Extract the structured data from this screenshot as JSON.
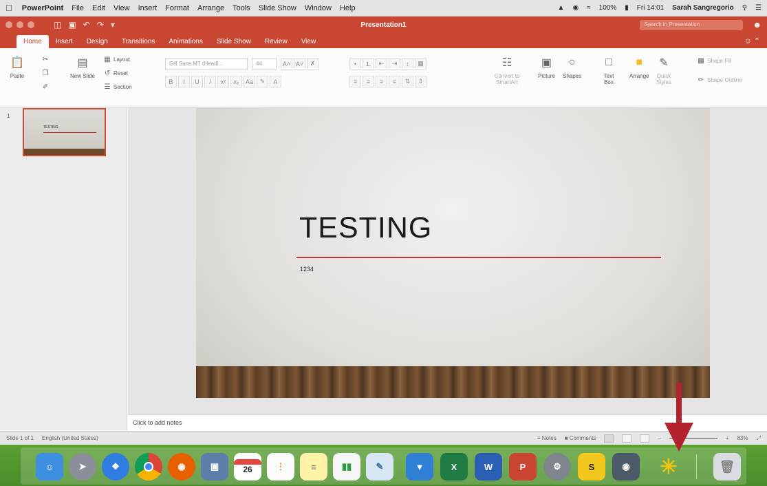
{
  "menubar": {
    "app_name": "PowerPoint",
    "items": [
      "File",
      "Edit",
      "View",
      "Insert",
      "Format",
      "Arrange",
      "Tools",
      "Slide Show",
      "Window",
      "Help"
    ],
    "battery": "100%",
    "clock": "Fri 14:01",
    "user": "Sarah Sangregorio"
  },
  "titlebar": {
    "document_title": "Presentation1",
    "search_placeholder": "Search in Presentation"
  },
  "tabs": [
    "Home",
    "Insert",
    "Design",
    "Transitions",
    "Animations",
    "Slide Show",
    "Review",
    "View"
  ],
  "ribbon": {
    "paste": "Paste",
    "new_slide": "New Slide",
    "layout": "Layout",
    "reset": "Reset",
    "section": "Section",
    "font_name": "Gill Sans MT (Headi...",
    "font_size": "44",
    "convert_smartart": "Convert to SmartArt",
    "picture": "Picture",
    "shapes": "Shapes",
    "text_box": "Text Box",
    "arrange": "Arrange",
    "quick_styles": "Quick Styles",
    "shape_fill": "Shape Fill",
    "shape_outline": "Shape Outline"
  },
  "thumbnails": {
    "slide_number": "1",
    "thumb_title": "TESTING"
  },
  "slide": {
    "title": "TESTING",
    "subtitle": "1234"
  },
  "notes": {
    "placeholder": "Click to add notes"
  },
  "statusbar": {
    "slide_info": "Slide 1 of 1",
    "language": "English (United States)",
    "notes_label": "Notes",
    "comments_label": "Comments",
    "zoom": "83%"
  },
  "colors": {
    "accent": "#c94732",
    "slide_rule": "#b9353a",
    "dock_bg": "#4a8c2a",
    "arrow": "#b3232f"
  },
  "dock": {
    "calendar_day": "26",
    "apps": [
      "Finder",
      "Launchpad",
      "Safari",
      "Chrome",
      "Firefox",
      "Preview",
      "Calendar",
      "Reminders",
      "Notes",
      "Numbers",
      "Preview",
      "Keynote",
      "Excel",
      "Word",
      "PowerPoint",
      "System Preferences",
      "Skype",
      "Photo Booth",
      "Screenshot",
      "Trash"
    ]
  }
}
